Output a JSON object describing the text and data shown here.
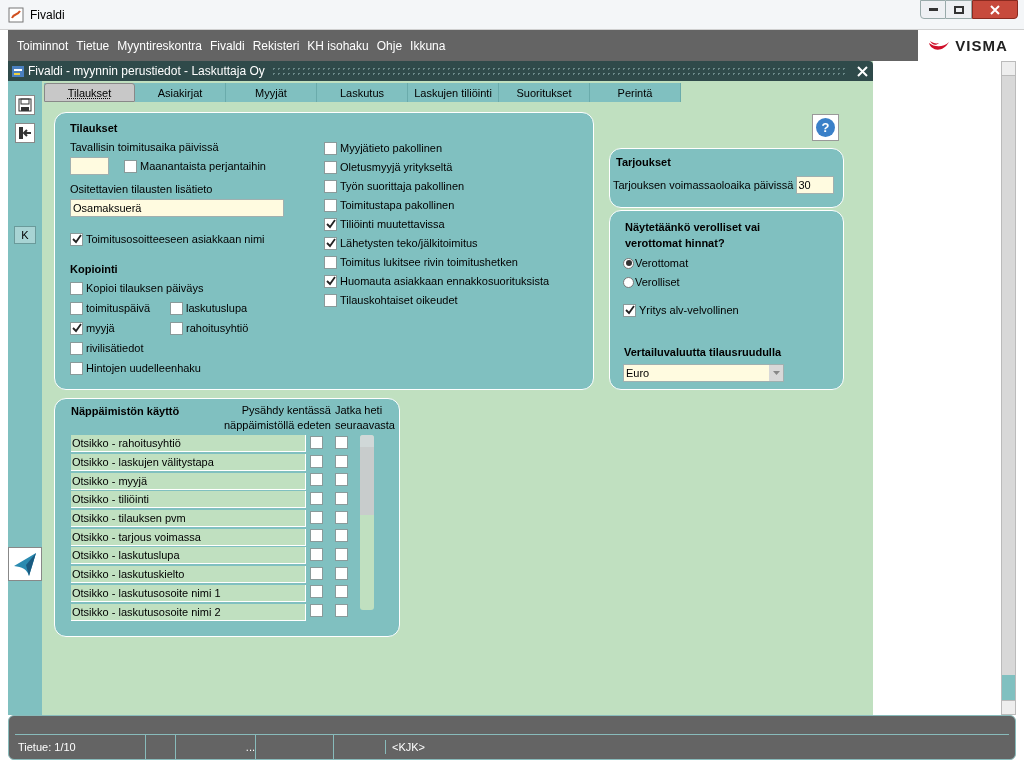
{
  "window": {
    "title": "Fivaldi"
  },
  "menu": [
    "Toiminnot",
    "Tietue",
    "Myyntireskontra",
    "Fivaldi",
    "Rekisteri",
    "KH isohaku",
    "Ohje",
    "Ikkuna"
  ],
  "brand": "VISMA",
  "inner_window": {
    "title": "Fivaldi - myynnin perustiedot - Laskuttaja Oy"
  },
  "toolbar": {
    "key_button": "K"
  },
  "help_button": "?",
  "tabs": [
    {
      "label": "Tilaukset",
      "selected": true
    },
    {
      "label": "Asiakirjat",
      "selected": false
    },
    {
      "label": "Myyjät",
      "selected": false
    },
    {
      "label": "Laskutus",
      "selected": false
    },
    {
      "label": "Laskujen tiliöinti",
      "selected": false
    },
    {
      "label": "Suoritukset",
      "selected": false
    },
    {
      "label": "Perintä",
      "selected": false
    }
  ],
  "orders": {
    "title": "Tilaukset",
    "delivery_days_label": "Tavallisin toimitusaika päivissä",
    "weekdays": {
      "label": "Maanantaista perjantaihin",
      "checked": false
    },
    "installment_label": "Ositettavien tilausten lisätieto",
    "installment_value": "Osamaksuerä",
    "customer_name": {
      "label": "Toimitusosoitteeseen asiakkaan nimi",
      "checked": true
    },
    "copy_title": "Kopiointi",
    "copy_rows": [
      [
        {
          "label": "Kopioi tilauksen päiväys",
          "checked": false
        }
      ],
      [
        {
          "label": "toimituspäivä",
          "checked": false
        },
        {
          "label": "laskutuslupa",
          "checked": false
        }
      ],
      [
        {
          "label": "myyjä",
          "checked": true
        },
        {
          "label": "rahoitusyhtiö",
          "checked": false
        }
      ],
      [
        {
          "label": "rivilisätiedot",
          "checked": false
        }
      ],
      [
        {
          "label": "Hintojen uudelleenhaku",
          "checked": false
        }
      ]
    ],
    "options": [
      {
        "label": "Myyjätieto pakollinen",
        "checked": false
      },
      {
        "label": "Oletusmyyjä yritykseltä",
        "checked": false
      },
      {
        "label": "Työn suorittaja pakollinen",
        "checked": false
      },
      {
        "label": "Toimitustapa pakollinen",
        "checked": false
      },
      {
        "label": "Tiliöinti muutettavissa",
        "checked": true
      },
      {
        "label": "Lähetysten teko/jälkitoimitus",
        "checked": true
      },
      {
        "label": "Toimitus lukitsee rivin toimitushetken",
        "checked": false
      },
      {
        "label": "Huomauta asiakkaan ennakkosuorituksista",
        "checked": true
      },
      {
        "label": "Tilauskohtaiset oikeudet",
        "checked": false
      }
    ]
  },
  "offers": {
    "title": "Tarjoukset",
    "validity_label": "Tarjouksen voimassaoloaika päivissä",
    "validity_value": "30"
  },
  "prices": {
    "question": "Näytetäänkö verolliset vai verottomat hinnat?",
    "radios": [
      {
        "label": "Verottomat",
        "selected": true
      },
      {
        "label": "Verolliset",
        "selected": false
      }
    ],
    "vat": {
      "label": "Yritys alv-velvollinen",
      "checked": true
    },
    "currency_label": "Vertailuvaluutta tilausruudulla",
    "currency": "Euro"
  },
  "keyboard": {
    "title": "Näppäimistön käyttö",
    "columns": [
      "Pysähdy kentässä näppäimistöllä edeten",
      "Jatka heti seuraavasta"
    ],
    "rows": [
      {
        "label": "Otsikko - rahoitusyhtiö",
        "stop": false,
        "continue": false
      },
      {
        "label": "Otsikko - laskujen välitystapa",
        "stop": false,
        "continue": false
      },
      {
        "label": "Otsikko - myyjä",
        "stop": false,
        "continue": false
      },
      {
        "label": "Otsikko - tiliöinti",
        "stop": false,
        "continue": false
      },
      {
        "label": "Otsikko - tilauksen pvm",
        "stop": false,
        "continue": false
      },
      {
        "label": "Otsikko - tarjous voimassa",
        "stop": false,
        "continue": false
      },
      {
        "label": "Otsikko - laskutuslupa",
        "stop": false,
        "continue": false
      },
      {
        "label": "Otsikko - laskutuskielto",
        "stop": false,
        "continue": false
      },
      {
        "label": "Otsikko - laskutusosoite nimi 1",
        "stop": false,
        "continue": false
      },
      {
        "label": "Otsikko - laskutusosoite nimi 2",
        "stop": false,
        "continue": false
      }
    ]
  },
  "status_bar": {
    "record": "Tietue: 1/10",
    "cell_3": "...",
    "mode": "<KJK>"
  }
}
